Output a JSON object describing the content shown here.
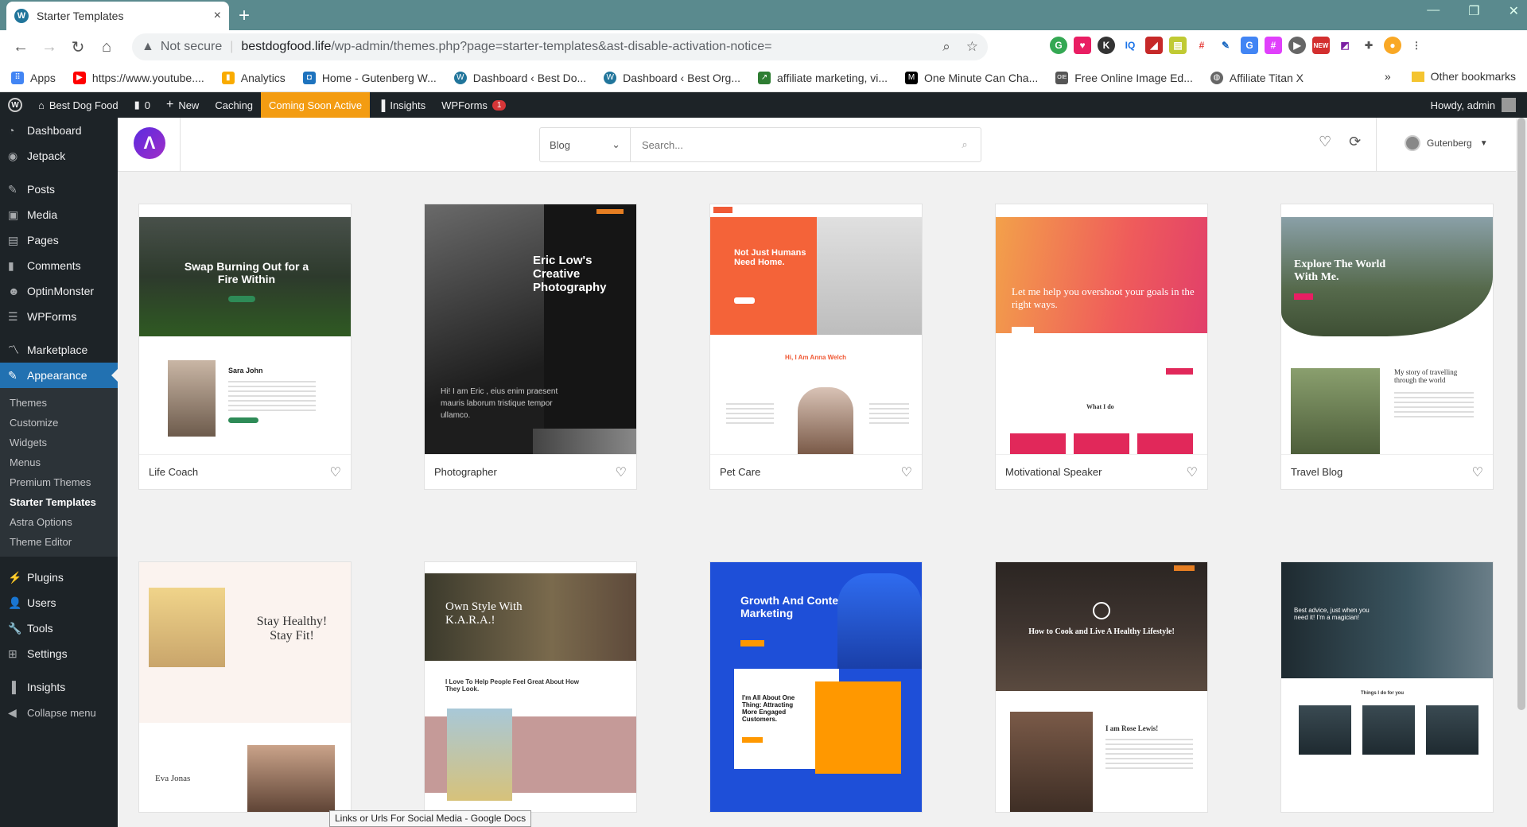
{
  "browser": {
    "tab_title": "Starter Templates",
    "tab_close": "×",
    "new_tab": "+",
    "security": "Not secure",
    "url_domain": "bestdogfood.life",
    "url_path": "/wp-admin/themes.php?page=starter-templates&ast-disable-activation-notice=",
    "bookmarks": [
      {
        "label": "Apps",
        "icon": "apps-icon",
        "color": "#4285f4"
      },
      {
        "label": "https://www.youtube....",
        "icon": "youtube-icon",
        "color": "#ff0000"
      },
      {
        "label": "Analytics",
        "icon": "analytics-icon",
        "color": "#f9ab00"
      },
      {
        "label": "Home - Gutenberg W...",
        "icon": "gutenberg-icon",
        "color": "#1e73be"
      },
      {
        "label": "Dashboard ‹ Best Do...",
        "icon": "wordpress-icon",
        "color": "#21759b"
      },
      {
        "label": "Dashboard ‹ Best Org...",
        "icon": "wordpress-icon",
        "color": "#21759b"
      },
      {
        "label": "affiliate marketing, vi...",
        "icon": "trend-icon",
        "color": "#2e7d32"
      },
      {
        "label": "One Minute Can Cha...",
        "icon": "medium-icon",
        "color": "#000000"
      },
      {
        "label": "Free Online Image Ed...",
        "icon": "oie-icon",
        "color": "#555555"
      },
      {
        "label": "Affiliate Titan X",
        "icon": "globe-icon",
        "color": "#666666"
      }
    ],
    "other_bookmarks": "Other bookmarks",
    "bookmarks_more": "»"
  },
  "adminbar": {
    "site_name": "Best Dog Food",
    "comments_count": "0",
    "new_label": "New",
    "caching": "Caching",
    "coming_soon": "Coming Soon Active",
    "insights": "Insights",
    "wpforms": "WPForms",
    "wpforms_badge": "1",
    "howdy": "Howdy, admin"
  },
  "sidebar": {
    "items_top": [
      {
        "label": "Dashboard",
        "icon": "dashboard-icon"
      },
      {
        "label": "Jetpack",
        "icon": "jetpack-icon"
      }
    ],
    "items_mid": [
      {
        "label": "Posts",
        "icon": "pin-icon"
      },
      {
        "label": "Media",
        "icon": "media-icon"
      },
      {
        "label": "Pages",
        "icon": "pages-icon"
      },
      {
        "label": "Comments",
        "icon": "comments-icon"
      },
      {
        "label": "OptinMonster",
        "icon": "optinmonster-icon"
      },
      {
        "label": "WPForms",
        "icon": "wpforms-icon"
      }
    ],
    "marketplace": "Marketplace",
    "appearance": "Appearance",
    "submenu": [
      "Themes",
      "Customize",
      "Widgets",
      "Menus",
      "Premium Themes",
      "Starter Templates",
      "Astra Options",
      "Theme Editor"
    ],
    "items_bottom": [
      {
        "label": "Plugins",
        "icon": "plugins-icon"
      },
      {
        "label": "Users",
        "icon": "users-icon"
      },
      {
        "label": "Tools",
        "icon": "tools-icon"
      },
      {
        "label": "Settings",
        "icon": "settings-icon"
      }
    ],
    "insights": "Insights",
    "collapse": "Collapse menu"
  },
  "header": {
    "category": "Blog",
    "search_placeholder": "Search...",
    "page_builder": "Gutenberg"
  },
  "templates": [
    {
      "name": "Life Coach",
      "headline": "Swap Burning Out for a Fire Within",
      "sub": "Sara John"
    },
    {
      "name": "Photographer",
      "headline": "Eric Low's Creative Photography",
      "sub": "Hi! I am Eric , eius enim praesent mauris laborum tristique tempor ullamco."
    },
    {
      "name": "Pet Care",
      "headline": "Not Just Humans Need Home.",
      "sub": "Hi, I Am Anna Welch"
    },
    {
      "name": "Motivational Speaker",
      "headline": "Let me help you overshoot your goals in the right ways.",
      "sub": "What I do"
    },
    {
      "name": "Travel Blog",
      "headline": "Explore The World With Me.",
      "sub": "My story of travelling through the world"
    },
    {
      "name": "",
      "headline": "Stay Healthy! Stay Fit!",
      "sub": "Eva Jonas"
    },
    {
      "name": "",
      "headline": "Own Style With K.A.R.A.!",
      "sub": "I Love To Help People Feel Great About How They Look."
    },
    {
      "name": "",
      "headline": "Growth And Content Marketing",
      "sub": "I'm All About One Thing: Attracting More Engaged Customers."
    },
    {
      "name": "",
      "headline": "How to Cook and Live A Healthy Lifestyle!",
      "sub": "I am Rose Lewis!"
    },
    {
      "name": "",
      "headline": "Best advice, just when you need it! I'm a magician!",
      "sub": "Things I do for you"
    }
  ],
  "status_tooltip": "Links or Urls For Social Media - Google Docs"
}
